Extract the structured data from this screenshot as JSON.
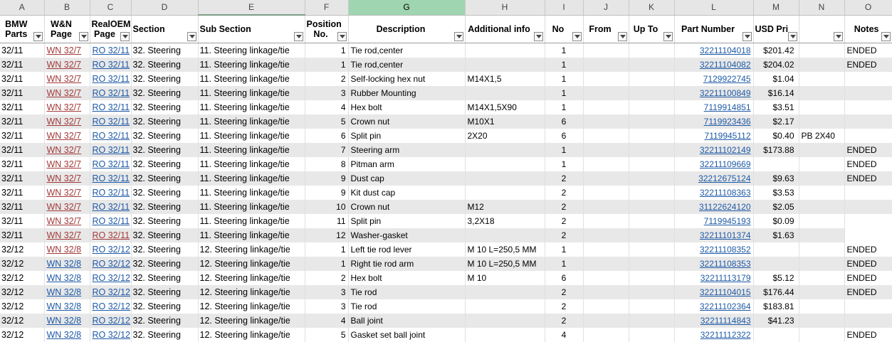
{
  "columns": [
    "A",
    "B",
    "C",
    "D",
    "E",
    "F",
    "G",
    "H",
    "I",
    "J",
    "K",
    "L",
    "M",
    "N",
    "O"
  ],
  "headers": {
    "a": [
      "BMW",
      "Parts"
    ],
    "b": [
      "W&N",
      "Page"
    ],
    "c": [
      "RealOEM",
      "Page"
    ],
    "d": "Section",
    "e": "Sub Section",
    "f": [
      "Position",
      "No."
    ],
    "g": "Description",
    "h": "Additional info",
    "i": "No",
    "j": "From",
    "k": "Up To",
    "l": "Part Number",
    "m": "USD Pri",
    "n": "",
    "o": "Notes"
  },
  "rows": [
    {
      "a": "32/11",
      "b": "WN 32/7",
      "c": "RO 32/11",
      "d": "32. Steering",
      "e": "11. Steering linkage/tie",
      "f": "1",
      "g": "Tie rod,center",
      "h": "",
      "i": "1",
      "j": "",
      "k": "",
      "l": "32211104018",
      "m": "$201.42",
      "n": "",
      "o": "ENDED"
    },
    {
      "a": "32/11",
      "b": "WN 32/7",
      "c": "RO 32/11",
      "d": "32. Steering",
      "e": "11. Steering linkage/tie",
      "f": "1",
      "g": "Tie rod,center",
      "h": "",
      "i": "1",
      "j": "",
      "k": "",
      "l": "32211104082",
      "m": "$204.02",
      "n": "",
      "o": "ENDED"
    },
    {
      "a": "32/11",
      "b": "WN 32/7",
      "c": "RO 32/11",
      "d": "32. Steering",
      "e": "11. Steering linkage/tie",
      "f": "2",
      "g": "Self-locking hex nut",
      "h": "M14X1,5",
      "i": "1",
      "j": "",
      "k": "",
      "l": "7129922745",
      "m": "$1.04",
      "n": "",
      "o": ""
    },
    {
      "a": "32/11",
      "b": "WN 32/7",
      "c": "RO 32/11",
      "d": "32. Steering",
      "e": "11. Steering linkage/tie",
      "f": "3",
      "g": "Rubber Mounting",
      "h": "",
      "i": "1",
      "j": "",
      "k": "",
      "l": "32211100849",
      "m": "$16.14",
      "n": "",
      "o": ""
    },
    {
      "a": "32/11",
      "b": "WN 32/7",
      "c": "RO 32/11",
      "d": "32. Steering",
      "e": "11. Steering linkage/tie",
      "f": "4",
      "g": "Hex bolt",
      "h": "M14X1,5X90",
      "i": "1",
      "j": "",
      "k": "",
      "l": "7119914851",
      "m": "$3.51",
      "n": "",
      "o": ""
    },
    {
      "a": "32/11",
      "b": "WN 32/7",
      "c": "RO 32/11",
      "d": "32. Steering",
      "e": "11. Steering linkage/tie",
      "f": "5",
      "g": "Crown nut",
      "h": "M10X1",
      "i": "6",
      "j": "",
      "k": "",
      "l": "7119923436",
      "m": "$2.17",
      "n": "",
      "o": ""
    },
    {
      "a": "32/11",
      "b": "WN 32/7",
      "c": "RO 32/11",
      "d": "32. Steering",
      "e": "11. Steering linkage/tie",
      "f": "6",
      "g": "Split pin",
      "h": "2X20",
      "i": "6",
      "j": "",
      "k": "",
      "l": "7119945112",
      "m": "$0.40",
      "n": "PB 2X40",
      "o": ""
    },
    {
      "a": "32/11",
      "b": "WN 32/7",
      "c": "RO 32/11",
      "d": "32. Steering",
      "e": "11. Steering linkage/tie",
      "f": "7",
      "g": "Steering arm",
      "h": "",
      "i": "1",
      "j": "",
      "k": "",
      "l": "32211102149",
      "m": "$173.88",
      "n": "",
      "o": "ENDED"
    },
    {
      "a": "32/11",
      "b": "WN 32/7",
      "c": "RO 32/11",
      "d": "32. Steering",
      "e": "11. Steering linkage/tie",
      "f": "8",
      "g": "Pitman arm",
      "h": "",
      "i": "1",
      "j": "",
      "k": "",
      "l": "32211109669",
      "m": "",
      "n": "",
      "o": "ENDED"
    },
    {
      "a": "32/11",
      "b": "WN 32/7",
      "c": "RO 32/11",
      "d": "32. Steering",
      "e": "11. Steering linkage/tie",
      "f": "9",
      "g": "Dust cap",
      "h": "",
      "i": "2",
      "j": "",
      "k": "",
      "l": "32212675124",
      "m": "$9.63",
      "n": "",
      "o": "ENDED"
    },
    {
      "a": "32/11",
      "b": "WN 32/7",
      "c": "RO 32/11",
      "d": "32. Steering",
      "e": "11. Steering linkage/tie",
      "f": "9",
      "g": "Kit dust cap",
      "h": "",
      "i": "2",
      "j": "",
      "k": "",
      "l": "32211108363",
      "m": "$3.53",
      "n": "",
      "o": ""
    },
    {
      "a": "32/11",
      "b": "WN 32/7",
      "c": "RO 32/11",
      "d": "32. Steering",
      "e": "11. Steering linkage/tie",
      "f": "10",
      "g": "Crown nut",
      "h": "M12",
      "i": "2",
      "j": "",
      "k": "",
      "l": "31122624120",
      "m": "$2.05",
      "n": "",
      "o": ""
    },
    {
      "a": "32/11",
      "b": "WN 32/7",
      "c": "RO 32/11",
      "d": "32. Steering",
      "e": "11. Steering linkage/tie",
      "f": "11",
      "g": "Split pin",
      "h": "3,2X18",
      "i": "2",
      "j": "",
      "k": "",
      "l": "7119945193",
      "m": "$0.09",
      "n": "",
      "o": ""
    },
    {
      "a": "32/11",
      "b": "WN 32/7",
      "c": "RO 32/11",
      "d": "32. Steering",
      "e": "11. Steering linkage/tie",
      "f": "12",
      "g": "Washer-gasket",
      "h": "",
      "i": "2",
      "j": "",
      "k": "",
      "l": "32211101374",
      "m": "$1.63",
      "n": "",
      "o": ""
    },
    {
      "a": "32/12",
      "b": "WN 32/8",
      "c": "RO 32/12",
      "d": "32. Steering",
      "e": "12. Steering linkage/tie",
      "f": "1",
      "g": "Left tie rod lever",
      "h": "M 10 L=250,5 MM",
      "i": "1",
      "j": "",
      "k": "",
      "l": "32211108352",
      "m": "",
      "n": "",
      "o": "ENDED"
    },
    {
      "a": "32/12",
      "b": "WN 32/8",
      "c": "RO 32/12",
      "d": "32. Steering",
      "e": "12. Steering linkage/tie",
      "f": "1",
      "g": "Right tie rod arm",
      "h": "M 10 L=250,5 MM",
      "i": "1",
      "j": "",
      "k": "",
      "l": "32211108353",
      "m": "",
      "n": "",
      "o": "ENDED"
    },
    {
      "a": "32/12",
      "b": "WN 32/8",
      "c": "RO 32/12",
      "d": "32. Steering",
      "e": "12. Steering linkage/tie",
      "f": "2",
      "g": "Hex bolt",
      "h": "M 10",
      "i": "6",
      "j": "",
      "k": "",
      "l": "32211113179",
      "m": "$5.12",
      "n": "",
      "o": "ENDED"
    },
    {
      "a": "32/12",
      "b": "WN 32/8",
      "c": "RO 32/12",
      "d": "32. Steering",
      "e": "12. Steering linkage/tie",
      "f": "3",
      "g": "Tie rod",
      "h": "",
      "i": "2",
      "j": "",
      "k": "",
      "l": "32211104015",
      "m": "$176.44",
      "n": "",
      "o": "ENDED"
    },
    {
      "a": "32/12",
      "b": "WN 32/8",
      "c": "RO 32/12",
      "d": "32. Steering",
      "e": "12. Steering linkage/tie",
      "f": "3",
      "g": "Tie rod",
      "h": "",
      "i": "2",
      "j": "",
      "k": "",
      "l": "32211102364",
      "m": "$183.81",
      "n": "",
      "o": ""
    },
    {
      "a": "32/12",
      "b": "WN 32/8",
      "c": "RO 32/12",
      "d": "32. Steering",
      "e": "12. Steering linkage/tie",
      "f": "4",
      "g": "Ball joint",
      "h": "",
      "i": "2",
      "j": "",
      "k": "",
      "l": "32211114843",
      "m": "$41.23",
      "n": "",
      "o": ""
    },
    {
      "a": "32/12",
      "b": "WN 32/8",
      "c": "RO 32/12",
      "d": "32. Steering",
      "e": "12. Steering linkage/tie",
      "f": "5",
      "g": "Gasket set ball joint",
      "h": "",
      "i": "4",
      "j": "",
      "k": "",
      "l": "32211112322",
      "m": "",
      "n": "",
      "o": "ENDED"
    }
  ],
  "colors": {
    "link": "#1f5aa6",
    "visited_link": "#a23a3a",
    "selected_col": "#9fd5b0",
    "row_shade": "#e8e8e8"
  }
}
